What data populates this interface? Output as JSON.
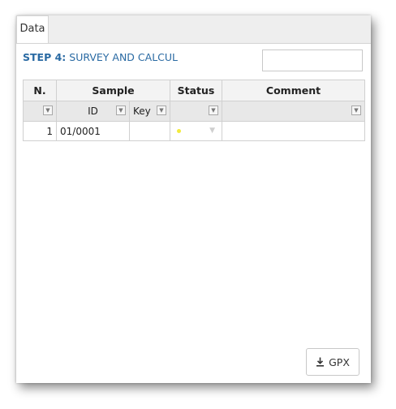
{
  "tabs": [
    {
      "label": "Data"
    }
  ],
  "step": {
    "prefix": "STEP 4:",
    "title": "SURVEY AND CALCUL"
  },
  "search": {
    "value": "",
    "placeholder": ""
  },
  "table": {
    "header_groups": [
      "N.",
      "Sample",
      "Status",
      "Comment"
    ],
    "subheaders": [
      "",
      "ID",
      "Key",
      "",
      ""
    ],
    "rows": [
      {
        "n": "1",
        "id": "01/0001",
        "key": "",
        "status_color": "#f2ea3c",
        "comment": ""
      }
    ]
  },
  "icons": {
    "filter": "filter-icon",
    "download": "download-icon",
    "dropdown": "chevron-down-icon"
  },
  "buttons": {
    "gpx": "GPX"
  }
}
